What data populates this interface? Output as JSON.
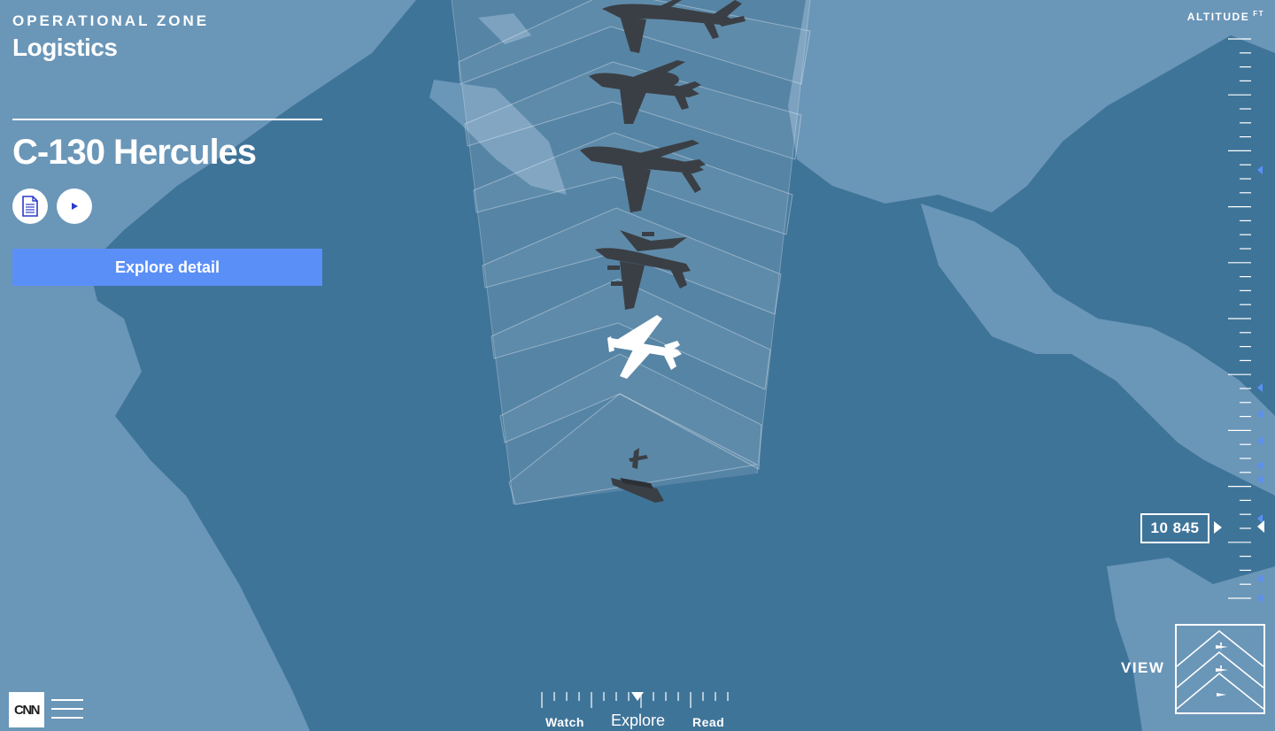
{
  "zone": {
    "label": "OPERATIONAL ZONE",
    "name": "Logistics"
  },
  "aircraft": {
    "name": "C-130 Hercules",
    "read_icon": "document-icon",
    "watch_icon": "play-icon",
    "explore_label": "Explore detail"
  },
  "altitude": {
    "title": "ALTITUDE",
    "unit": "FT",
    "value": "10 845"
  },
  "view": {
    "label": "VIEW"
  },
  "mode_nav": {
    "items": [
      {
        "label": "Watch",
        "active": false
      },
      {
        "label": "Explore",
        "active": true
      },
      {
        "label": "Read",
        "active": false
      }
    ]
  },
  "brand": {
    "logo": "CNN",
    "menu_icon": "hamburger-menu-icon"
  },
  "colors": {
    "ocean": "#3f7499",
    "land": "#6a96b8",
    "accent": "#5b8ff8",
    "aircraft_selected": "#ffffff",
    "aircraft_other": "#3a3f45"
  }
}
